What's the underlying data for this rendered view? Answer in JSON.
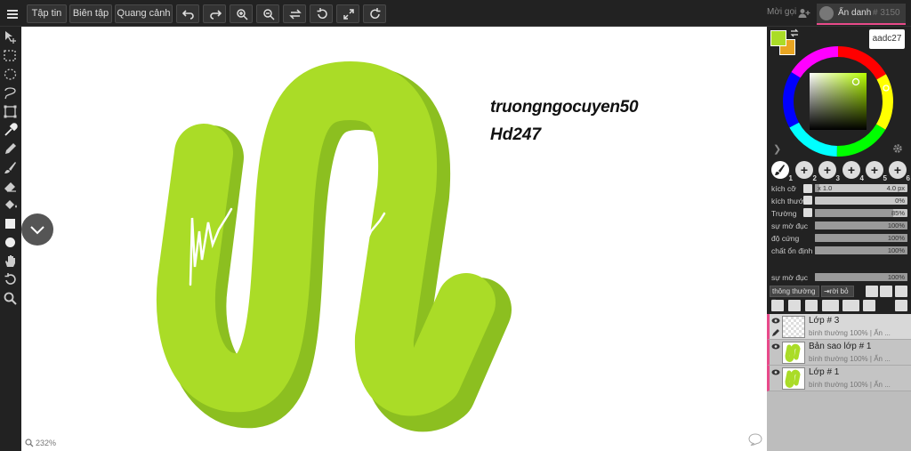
{
  "toolbar": {
    "menu_file": "Tập tin",
    "menu_edit": "Biên tập",
    "menu_view": "Quang cảnh"
  },
  "user": {
    "invite": "Mời gọi",
    "name": "Ẩn danh",
    "number": "# 3150"
  },
  "canvas": {
    "text_line1": "truongngocuyen50",
    "text_line2": "Hd247",
    "zoom": "232%",
    "stroke_color": "#aadc27"
  },
  "color": {
    "primary": "#aadc27",
    "secondary": "#e8a522",
    "hex_tooltip": "aadc27"
  },
  "brushes": {
    "slots": [
      "1",
      "2",
      "3",
      "4",
      "5",
      "6"
    ]
  },
  "brush_props": {
    "size_label": "kích cỡ",
    "size_min": "x 1.0",
    "size_value": "4.0 px",
    "spacing_label": "kích thước",
    "spacing_value": "0%",
    "flow_label": "Trường",
    "flow_value": "85%",
    "opacity_label": "sự mờ đục",
    "opacity_value": "100%",
    "hardness_label": "độ cứng",
    "hardness_value": "100%",
    "stabilizer_label": "chất ổn định",
    "stabilizer_value": "100%",
    "layer_opacity_label": "sự mờ đục",
    "layer_opacity_value": "100%"
  },
  "layer_controls": {
    "blend_mode": "thông thường",
    "detach": "rời bỏ"
  },
  "layers": [
    {
      "name": "Lớp # 3",
      "mode": "bình thường",
      "opacity": "100%",
      "hidden": "Ẩn ..."
    },
    {
      "name": "Bản sao lớp # 1",
      "mode": "bình thường",
      "opacity": "100%",
      "hidden": "Ẩn ..."
    },
    {
      "name": "Lớp # 1",
      "mode": "bình thường",
      "opacity": "100%",
      "hidden": "Ẩn ..."
    }
  ]
}
